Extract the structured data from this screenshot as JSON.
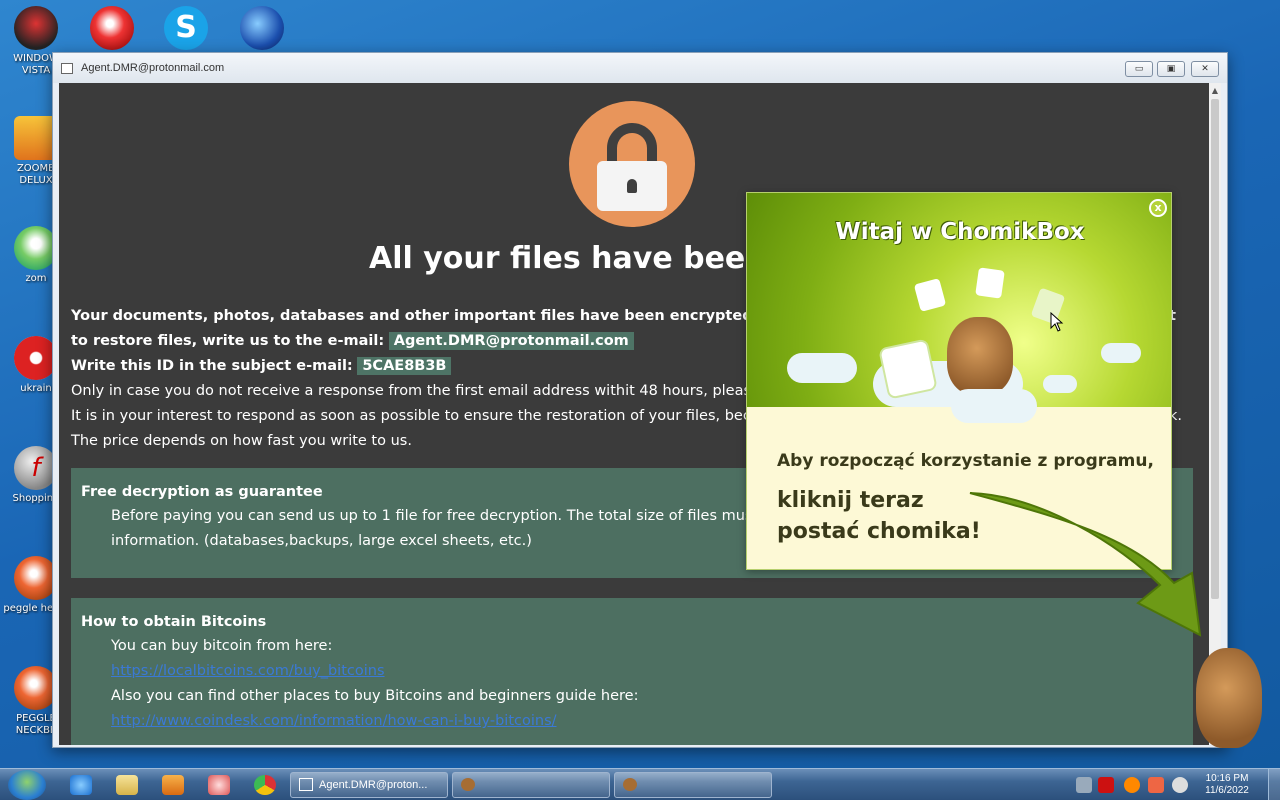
{
  "desktop": {
    "icons": [
      {
        "label": "WINDOW VISTA",
        "name": "windows-vista-icon"
      },
      {
        "label": "ZOOMB DELUX",
        "name": "zoomba-icon"
      },
      {
        "label": "zom",
        "name": "zombie-icon"
      },
      {
        "label": "ukrain",
        "name": "ukraine-icon"
      },
      {
        "label": "Shopping",
        "name": "flash-icon"
      },
      {
        "label": "peggle heggl",
        "name": "peggle-icon"
      },
      {
        "label": "PEGGLE NECKBE",
        "name": "peggle-neckbeard-icon"
      }
    ]
  },
  "window": {
    "title": "Agent.DMR@protonmail.com",
    "controls": {
      "minimize": "▭",
      "restore": "▣",
      "close": "✕"
    }
  },
  "ransom": {
    "headline": "All your files have been e",
    "p1_a": "Your documents, photos, databases and other important files have been encrypted with str",
    "p1_b": "t",
    "p2_a": "to restore files, write us to the e-mail:",
    "email": "Agent.DMR@protonmail.com",
    "p3_a": "Write this ID in the subject e-mail:",
    "id": "5CAE8B3B",
    "p4": "Only in case you do not receive a response from the first email address withit 48 hours, please use this",
    "p5_a": "It is in your interest to respond as soon as possible to ensure the restoration of your files, because we w",
    "p5_b": "k.",
    "p6": "The price depends on how fast you write to us.",
    "guarantee": {
      "title": "Free decryption as guarantee",
      "line1": "Before paying you can send us up to 1 file for free decryption. The total size of files must be less",
      "line2": "information. (databases,backups, large excel sheets, etc.)"
    },
    "bitcoin": {
      "title": "How to obtain Bitcoins",
      "line1": "You can buy bitcoin from here:",
      "link1": "https://localbitcoins.com/buy_bitcoins",
      "line2": "Also you can find other places to buy Bitcoins and beginners guide here:",
      "link2": "http://www.coindesk.com/information/how-can-i-buy-bitcoins/"
    }
  },
  "popup": {
    "title": "Witaj w ChomikBox",
    "close": "x",
    "message1": "Aby rozpocząć korzystanie z programu,",
    "message2_line1": "kliknij teraz",
    "message2_line2": "postać chomika!"
  },
  "taskbar": {
    "tasks": [
      {
        "label": "Agent.DMR@proton...",
        "name": "task-ransom-window"
      },
      {
        "label": "",
        "name": "task-chomik-1"
      },
      {
        "label": "",
        "name": "task-chomik-2"
      }
    ],
    "clock_time": "10:16 PM",
    "clock_date": "11/6/2022"
  },
  "colors": {
    "ransom_bg": "#3b3b3b",
    "lock_circle": "#e8955b",
    "green_box": "#4d6f61",
    "popup_green": "#7fae14"
  }
}
